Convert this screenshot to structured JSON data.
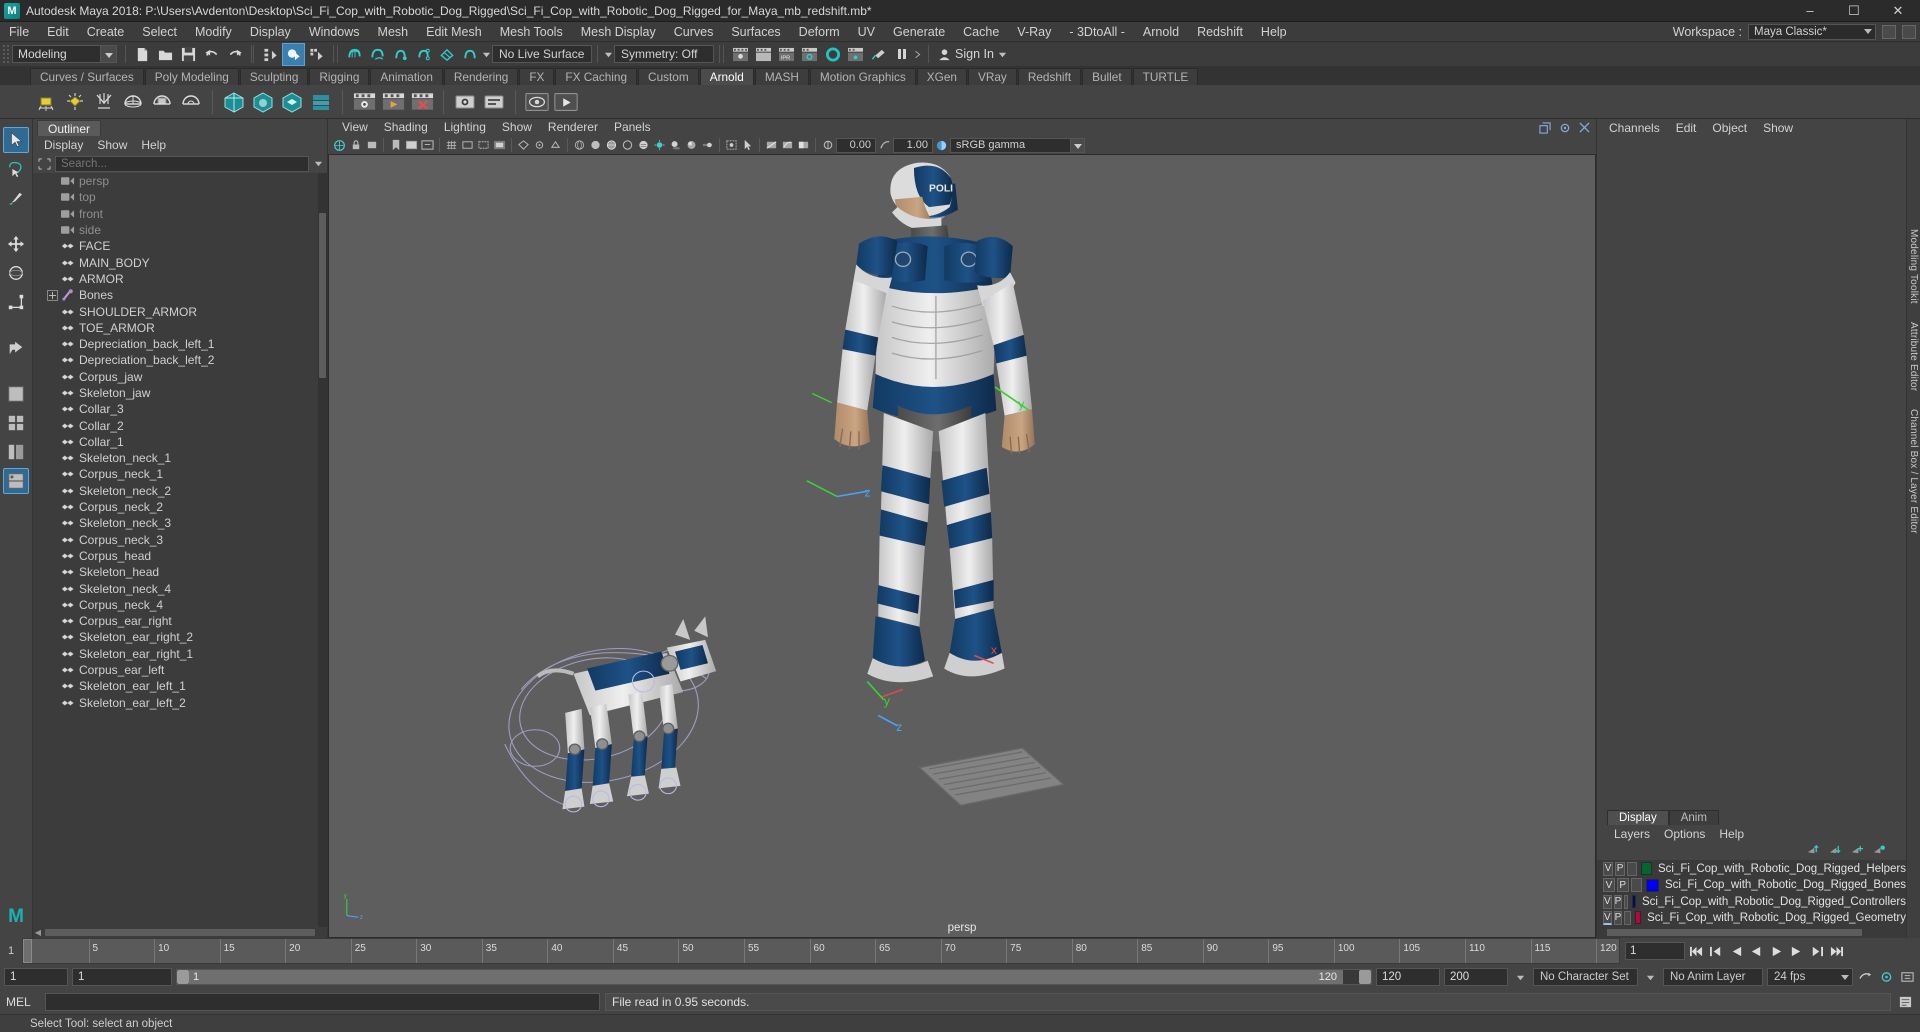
{
  "window": {
    "title": "Autodesk Maya 2018: P:\\Users\\Avdenton\\Desktop\\Sci_Fi_Cop_with_Robotic_Dog_Rigged\\Sci_Fi_Cop_with_Robotic_Dog_Rigged_for_Maya_mb_redshift.mb*",
    "logo": "M",
    "minimize": "–",
    "maximize": "☐",
    "close": "✕"
  },
  "menubar": {
    "items": [
      "File",
      "Edit",
      "Create",
      "Select",
      "Modify",
      "Display",
      "Windows",
      "Mesh",
      "Edit Mesh",
      "Mesh Tools",
      "Mesh Display",
      "Curves",
      "Surfaces",
      "Deform",
      "UV",
      "Generate",
      "Cache",
      "V-Ray",
      "- 3DtoAll -",
      "Arnold",
      "Redshift",
      "Help"
    ],
    "workspace_label": "Workspace :",
    "workspace_value": "Maya Classic*"
  },
  "statusline": {
    "mode": "Modeling",
    "live_surface": "No Live Surface",
    "symmetry": "Symmetry: Off",
    "signin": "Sign In",
    "icons": [
      "new-scene-icon",
      "open-scene-icon",
      "save-scene-icon",
      "undo-icon",
      "redo-icon",
      "select-by-hierarchy-icon",
      "select-by-object-icon",
      "select-by-component-icon",
      "snap-to-grid-icon",
      "snap-to-curve-icon",
      "snap-to-point-icon",
      "snap-to-projected-center-icon",
      "snap-to-view-plane-icon",
      "make-live-icon",
      "render-current-frame-icon",
      "ipr-render-icon",
      "render-settings-icon",
      "hypershade-icon",
      "render-view-icon",
      "light-icon",
      "pause-icon",
      "user-icon"
    ]
  },
  "shelf": {
    "tabs": [
      "Curves / Surfaces",
      "Poly Modeling",
      "Sculpting",
      "Rigging",
      "Animation",
      "Rendering",
      "FX",
      "FX Caching",
      "Custom",
      "Arnold",
      "MASH",
      "Motion Graphics",
      "XGen",
      "VRay",
      "Redshift",
      "Bullet",
      "TURTLE"
    ],
    "selected": "Arnold",
    "buttons": [
      "arnold-area-light-icon",
      "arnold-point-light-icon",
      "arnold-distant-light-icon",
      "arnold-skydome-light-icon",
      "arnold-mesh-light-icon",
      "arnold-photometric-light-icon",
      "arnold-standin-icon",
      "arnold-volume-icon",
      "arnold-procedural-icon",
      "arnold-scene-source-icon",
      "arnold-flush-caches-icon",
      "arnold-render-icon",
      "arnold-render-sequence-icon",
      "arnold-abort-render-icon",
      "arnold-open-render-view-icon",
      "arnold-tx-manager-icon",
      "arnold-license-icon",
      "arnold-play-icon"
    ]
  },
  "toolbox": {
    "tools": [
      {
        "name": "select-tool",
        "selected": true
      },
      {
        "name": "lasso-select-tool",
        "selected": false
      },
      {
        "name": "paint-select-tool",
        "selected": false
      },
      {
        "name": "move-tool",
        "selected": false
      },
      {
        "name": "rotate-tool",
        "selected": false
      },
      {
        "name": "scale-tool",
        "selected": false
      },
      {
        "name": "last-tool-used",
        "selected": false
      },
      {
        "name": "single-perspective-layout",
        "selected": false
      },
      {
        "name": "four-view-layout",
        "selected": false
      },
      {
        "name": "persp-outliner-layout",
        "selected": false
      },
      {
        "name": "persp-graph-layout",
        "selected": true
      }
    ],
    "logo": "M"
  },
  "outliner": {
    "tab": "Outliner",
    "menus": [
      "Display",
      "Show",
      "Help"
    ],
    "search_placeholder": "Search...",
    "search_value": "",
    "items": [
      {
        "label": "persp",
        "icon": "camera-icon",
        "dim": true,
        "indent": 1
      },
      {
        "label": "top",
        "icon": "camera-icon",
        "dim": true,
        "indent": 1
      },
      {
        "label": "front",
        "icon": "camera-icon",
        "dim": true,
        "indent": 1
      },
      {
        "label": "side",
        "icon": "camera-icon",
        "dim": true,
        "indent": 1
      },
      {
        "label": "FACE",
        "icon": "mesh-icon",
        "dim": false,
        "indent": 1
      },
      {
        "label": "MAIN_BODY",
        "icon": "mesh-icon",
        "dim": false,
        "indent": 1
      },
      {
        "label": "ARMOR",
        "icon": "mesh-icon",
        "dim": false,
        "indent": 1
      },
      {
        "label": "Bones",
        "icon": "joint-icon",
        "dim": false,
        "indent": 1,
        "expandable": true
      },
      {
        "label": "SHOULDER_ARMOR",
        "icon": "mesh-icon",
        "dim": false,
        "indent": 1
      },
      {
        "label": "TOE_ARMOR",
        "icon": "mesh-icon",
        "dim": false,
        "indent": 1
      },
      {
        "label": "Depreciation_back_left_1",
        "icon": "mesh-icon",
        "dim": false,
        "indent": 1
      },
      {
        "label": "Depreciation_back_left_2",
        "icon": "mesh-icon",
        "dim": false,
        "indent": 1
      },
      {
        "label": "Corpus_jaw",
        "icon": "mesh-icon",
        "dim": false,
        "indent": 1
      },
      {
        "label": "Skeleton_jaw",
        "icon": "mesh-icon",
        "dim": false,
        "indent": 1
      },
      {
        "label": "Collar_3",
        "icon": "mesh-icon",
        "dim": false,
        "indent": 1
      },
      {
        "label": "Collar_2",
        "icon": "mesh-icon",
        "dim": false,
        "indent": 1
      },
      {
        "label": "Collar_1",
        "icon": "mesh-icon",
        "dim": false,
        "indent": 1
      },
      {
        "label": "Skeleton_neck_1",
        "icon": "mesh-icon",
        "dim": false,
        "indent": 1
      },
      {
        "label": "Corpus_neck_1",
        "icon": "mesh-icon",
        "dim": false,
        "indent": 1
      },
      {
        "label": "Skeleton_neck_2",
        "icon": "mesh-icon",
        "dim": false,
        "indent": 1
      },
      {
        "label": "Corpus_neck_2",
        "icon": "mesh-icon",
        "dim": false,
        "indent": 1
      },
      {
        "label": "Skeleton_neck_3",
        "icon": "mesh-icon",
        "dim": false,
        "indent": 1
      },
      {
        "label": "Corpus_neck_3",
        "icon": "mesh-icon",
        "dim": false,
        "indent": 1
      },
      {
        "label": "Corpus_head",
        "icon": "mesh-icon",
        "dim": false,
        "indent": 1
      },
      {
        "label": "Skeleton_head",
        "icon": "mesh-icon",
        "dim": false,
        "indent": 1
      },
      {
        "label": "Skeleton_neck_4",
        "icon": "mesh-icon",
        "dim": false,
        "indent": 1
      },
      {
        "label": "Corpus_neck_4",
        "icon": "mesh-icon",
        "dim": false,
        "indent": 1
      },
      {
        "label": "Corpus_ear_right",
        "icon": "mesh-icon",
        "dim": false,
        "indent": 1
      },
      {
        "label": "Skeleton_ear_right_2",
        "icon": "mesh-icon",
        "dim": false,
        "indent": 1
      },
      {
        "label": "Skeleton_ear_right_1",
        "icon": "mesh-icon",
        "dim": false,
        "indent": 1
      },
      {
        "label": "Corpus_ear_left",
        "icon": "mesh-icon",
        "dim": false,
        "indent": 1
      },
      {
        "label": "Skeleton_ear_left_1",
        "icon": "mesh-icon",
        "dim": false,
        "indent": 1
      },
      {
        "label": "Skeleton_ear_left_2",
        "icon": "mesh-icon",
        "dim": false,
        "indent": 1
      }
    ]
  },
  "viewport": {
    "menus": [
      "View",
      "Shading",
      "Lighting",
      "Show",
      "Renderer",
      "Panels"
    ],
    "exposure": "0.00",
    "gamma_value": "1.00",
    "color_space": "sRGB gamma",
    "camera_label": "persp",
    "axis_labels": {
      "x": "x",
      "y": "y",
      "z": "z"
    }
  },
  "channelbox": {
    "tabs": [
      "Channels",
      "Edit",
      "Object",
      "Show"
    ]
  },
  "layereditor": {
    "tabs": [
      "Display",
      "Anim"
    ],
    "selected_tab": "Display",
    "menus": [
      "Layers",
      "Options",
      "Help"
    ],
    "col_v": "V",
    "col_p": "P",
    "layers": [
      {
        "name": "Sci_Fi_Cop_with_Robotic_Dog_Rigged_Helpers",
        "color": "#00682d",
        "v": "V",
        "p": "P",
        "selected": false
      },
      {
        "name": "Sci_Fi_Cop_with_Robotic_Dog_Rigged_Bones",
        "color": "#0000f0",
        "v": "V",
        "p": "P",
        "selected": false
      },
      {
        "name": "Sci_Fi_Cop_with_Robotic_Dog_Rigged_Controllers",
        "color": "#000b63",
        "v": "V",
        "p": "P",
        "selected": false
      },
      {
        "name": "Sci_Fi_Cop_with_Robotic_Dog_Rigged_Geometry",
        "color": "#c00040",
        "v": "V",
        "p": "P",
        "selected": true
      }
    ]
  },
  "timeline": {
    "start_frame": "1",
    "ticks": [
      "5",
      "10",
      "15",
      "20",
      "25",
      "30",
      "35",
      "40",
      "45",
      "50",
      "55",
      "60",
      "65",
      "70",
      "75",
      "80",
      "85",
      "90",
      "95",
      "100",
      "105",
      "110",
      "115",
      "120"
    ],
    "current_frame": "1",
    "playback_buttons": [
      "go-to-start-icon",
      "step-back-key-icon",
      "step-back-frame-icon",
      "play-backwards-icon",
      "play-forwards-icon",
      "step-forward-frame-icon",
      "step-forward-key-icon",
      "go-to-end-icon"
    ]
  },
  "rangeslider": {
    "anim_start": "1",
    "range_start": "1",
    "slider_start": "1",
    "slider_end": "120",
    "range_end": "120",
    "anim_end": "200",
    "character_set": "No Character Set",
    "anim_layer": "No Anim Layer",
    "fps": "24 fps",
    "icons": [
      "auto-key-icon",
      "animation-preferences-icon",
      "cycle-icon"
    ]
  },
  "command": {
    "label": "MEL",
    "input_value": "",
    "output": "File read in  0.95 seconds."
  },
  "helpline": {
    "text": "Select Tool: select an object"
  },
  "sidetabs": {
    "right": [
      "Modeling Toolkit",
      "Attribute Editor",
      "Channel Box / Layer Editor"
    ]
  },
  "colors": {
    "accent": "#3a7fb0",
    "teal": "#19b2b2",
    "panel": "#444444",
    "dark": "#2b2b2b",
    "list": "#3c3c3c"
  }
}
